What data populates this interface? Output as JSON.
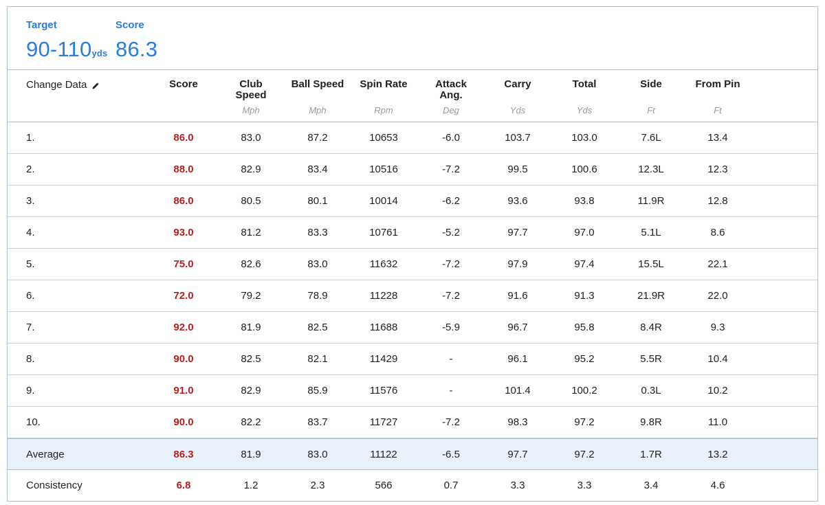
{
  "summary": {
    "target_label": "Target",
    "target_value": "90-110",
    "target_unit": "yds",
    "score_label": "Score",
    "score_value": "86.3"
  },
  "header": {
    "change_data": "Change Data",
    "columns": [
      {
        "name": "Score",
        "unit": ""
      },
      {
        "name": "Club Speed",
        "unit": "Mph"
      },
      {
        "name": "Ball Speed",
        "unit": "Mph"
      },
      {
        "name": "Spin Rate",
        "unit": "Rpm"
      },
      {
        "name": "Attack Ang.",
        "unit": "Deg"
      },
      {
        "name": "Carry",
        "unit": "Yds"
      },
      {
        "name": "Total",
        "unit": "Yds"
      },
      {
        "name": "Side",
        "unit": "Ft"
      },
      {
        "name": "From Pin",
        "unit": "Ft"
      }
    ]
  },
  "rows": [
    {
      "label": "1.",
      "values": [
        "86.0",
        "83.0",
        "87.2",
        "10653",
        "-6.0",
        "103.7",
        "103.0",
        "7.6L",
        "13.4"
      ]
    },
    {
      "label": "2.",
      "values": [
        "88.0",
        "82.9",
        "83.4",
        "10516",
        "-7.2",
        "99.5",
        "100.6",
        "12.3L",
        "12.3"
      ]
    },
    {
      "label": "3.",
      "values": [
        "86.0",
        "80.5",
        "80.1",
        "10014",
        "-6.2",
        "93.6",
        "93.8",
        "11.9R",
        "12.8"
      ]
    },
    {
      "label": "4.",
      "values": [
        "93.0",
        "81.2",
        "83.3",
        "10761",
        "-5.2",
        "97.7",
        "97.0",
        "5.1L",
        "8.6"
      ]
    },
    {
      "label": "5.",
      "values": [
        "75.0",
        "82.6",
        "83.0",
        "11632",
        "-7.2",
        "97.9",
        "97.4",
        "15.5L",
        "22.1"
      ]
    },
    {
      "label": "6.",
      "values": [
        "72.0",
        "79.2",
        "78.9",
        "11228",
        "-7.2",
        "91.6",
        "91.3",
        "21.9R",
        "22.0"
      ]
    },
    {
      "label": "7.",
      "values": [
        "92.0",
        "81.9",
        "82.5",
        "11688",
        "-5.9",
        "96.7",
        "95.8",
        "8.4R",
        "9.3"
      ]
    },
    {
      "label": "8.",
      "values": [
        "90.0",
        "82.5",
        "82.1",
        "11429",
        "-",
        "96.1",
        "95.2",
        "5.5R",
        "10.4"
      ]
    },
    {
      "label": "9.",
      "values": [
        "91.0",
        "82.9",
        "85.9",
        "11576",
        "-",
        "101.4",
        "100.2",
        "0.3L",
        "10.2"
      ]
    },
    {
      "label": "10.",
      "values": [
        "90.0",
        "82.2",
        "83.7",
        "11727",
        "-7.2",
        "98.3",
        "97.2",
        "9.8R",
        "11.0"
      ]
    },
    {
      "label": "Average",
      "values": [
        "86.3",
        "81.9",
        "83.0",
        "11122",
        "-6.5",
        "97.7",
        "97.2",
        "1.7R",
        "13.2"
      ],
      "highlight": true
    },
    {
      "label": "Consistency",
      "values": [
        "6.8",
        "1.2",
        "2.3",
        "566",
        "0.7",
        "3.3",
        "3.3",
        "3.4",
        "4.6"
      ]
    }
  ],
  "colors": {
    "accent": "#2a7be4",
    "score": "#b91d1d",
    "average_bg": "#e8f1fa",
    "border": "#a9c3dd"
  },
  "icons": {
    "change_data": "pencil-icon"
  }
}
